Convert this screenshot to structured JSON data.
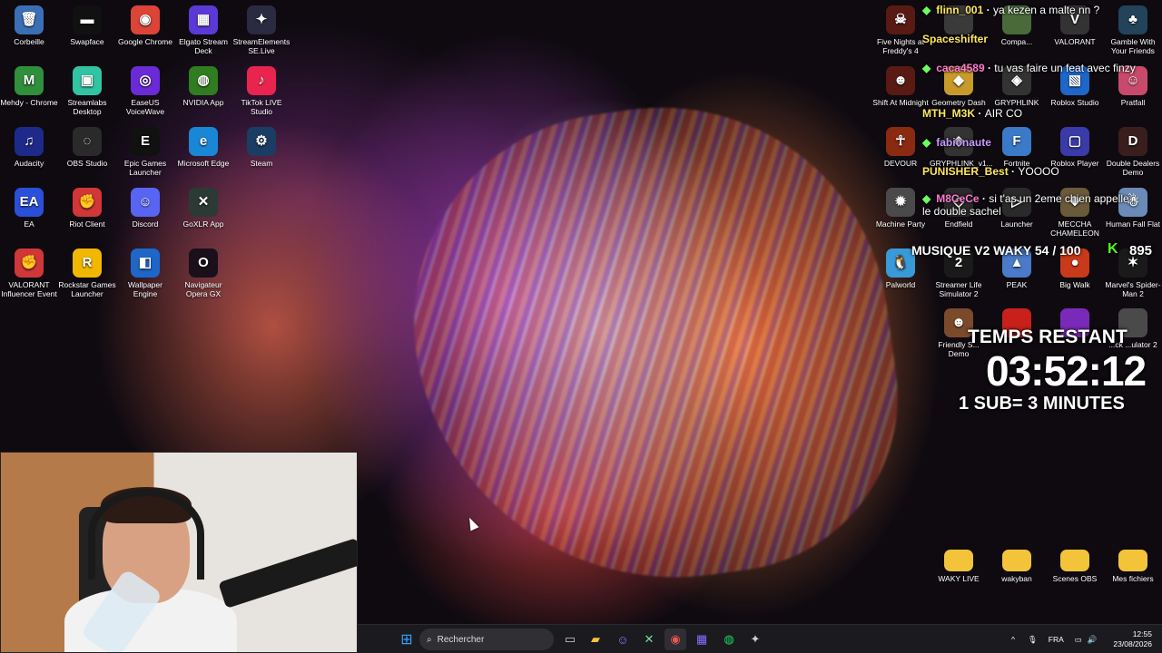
{
  "desktop_left": [
    {
      "label": "Corbeille",
      "icon": "recycle-bin-icon",
      "color": "#3b6fb5",
      "glyph": "🗑"
    },
    {
      "label": "Swapface",
      "icon": "mask-icon",
      "color": "#111111",
      "glyph": "▬"
    },
    {
      "label": "Google Chrome",
      "icon": "chrome-icon",
      "color": "#db4437",
      "glyph": "◉"
    },
    {
      "label": "Elgato Stream Deck",
      "icon": "stream-deck-icon",
      "color": "#5b39d6",
      "glyph": "▦"
    },
    {
      "label": "StreamElements SE.Live",
      "icon": "streamelements-icon",
      "color": "#2a2a40",
      "glyph": "✦"
    },
    {
      "label": "Mehdy - Chrome",
      "icon": "chrome-profile-icon",
      "color": "#2f8f3a",
      "glyph": "M"
    },
    {
      "label": "Streamlabs Desktop",
      "icon": "streamlabs-icon",
      "color": "#31c3a2",
      "glyph": "▣"
    },
    {
      "label": "EaseUS VoiceWave",
      "icon": "voicewave-icon",
      "color": "#6a2bd6",
      "glyph": "◎"
    },
    {
      "label": "NVIDIA App",
      "icon": "nvidia-icon",
      "color": "#2f7d1e",
      "glyph": "◍"
    },
    {
      "label": "TikTok LIVE Studio",
      "icon": "tiktok-icon",
      "color": "#e8244f",
      "glyph": "♪"
    },
    {
      "label": "Audacity",
      "icon": "audacity-icon",
      "color": "#1e2a8a",
      "glyph": "♫"
    },
    {
      "label": "OBS Studio",
      "icon": "obs-icon",
      "color": "#2a2a2a",
      "glyph": "◌"
    },
    {
      "label": "Epic Games Launcher",
      "icon": "epic-games-icon",
      "color": "#111111",
      "glyph": "E"
    },
    {
      "label": "Microsoft Edge",
      "icon": "edge-icon",
      "color": "#1a86d6",
      "glyph": "e"
    },
    {
      "label": "Steam",
      "icon": "steam-icon",
      "color": "#1b3c63",
      "glyph": "⚙"
    },
    {
      "label": "EA",
      "icon": "ea-icon",
      "color": "#2a4fd8",
      "glyph": "EA"
    },
    {
      "label": "Riot Client",
      "icon": "riot-client-icon",
      "color": "#d13639",
      "glyph": "✊"
    },
    {
      "label": "Discord",
      "icon": "discord-icon",
      "color": "#5865f2",
      "glyph": "☺"
    },
    {
      "label": "GoXLR App",
      "icon": "goxlr-icon",
      "color": "#2c3a35",
      "glyph": "✕"
    },
    {
      "label": "",
      "icon": "blank-icon",
      "color": "transparent",
      "glyph": ""
    },
    {
      "label": "VALORANT Influencer Event",
      "icon": "riot-event-icon",
      "color": "#d13639",
      "glyph": "✊"
    },
    {
      "label": "Rockstar Games Launcher",
      "icon": "rockstar-icon",
      "color": "#f2b700",
      "glyph": "R"
    },
    {
      "label": "Wallpaper Engine",
      "icon": "wallpaper-engine-icon",
      "color": "#1e66c8",
      "glyph": "◧"
    },
    {
      "label": "Navigateur Opera GX",
      "icon": "opera-gx-icon",
      "color": "#1a0f1a",
      "glyph": "O"
    }
  ],
  "desktop_right": [
    {
      "label": "Five Nights at Freddy's 4",
      "icon": "fnaf-icon",
      "color": "#5a1a14",
      "glyph": "☠"
    },
    {
      "label": "",
      "icon": "game-icon",
      "color": "#3a3a3a",
      "glyph": ""
    },
    {
      "label": "Compa...",
      "icon": "game-icon",
      "color": "#4a6a3a",
      "glyph": ""
    },
    {
      "label": "VALORANT",
      "icon": "valorant-icon",
      "color": "#333333",
      "glyph": "V"
    },
    {
      "label": "Gamble With Your Friends",
      "icon": "gamble-icon",
      "color": "#22435a",
      "glyph": "♣"
    },
    {
      "label": "Shift At Midnight",
      "icon": "shift-midnight-icon",
      "color": "#5a1a14",
      "glyph": "☻"
    },
    {
      "label": "Geometry Dash",
      "icon": "geometry-dash-icon",
      "color": "#c89a2a",
      "glyph": "◆"
    },
    {
      "label": "GRYPHLINK",
      "icon": "gryphlink-icon",
      "color": "#333333",
      "glyph": "◈"
    },
    {
      "label": "Roblox Studio",
      "icon": "roblox-studio-icon",
      "color": "#1e66c8",
      "glyph": "▧"
    },
    {
      "label": "Pratfall",
      "icon": "pratfall-icon",
      "color": "#c84a6a",
      "glyph": "☺"
    },
    {
      "label": "DEVOUR",
      "icon": "devour-icon",
      "color": "#8a2a10",
      "glyph": "☥"
    },
    {
      "label": "GRYPHLINK_v1...",
      "icon": "gryphlink-icon",
      "color": "#333333",
      "glyph": "◈"
    },
    {
      "label": "Fortnite",
      "icon": "fortnite-icon",
      "color": "#3a7ac8",
      "glyph": "F"
    },
    {
      "label": "Roblox Player",
      "icon": "roblox-player-icon",
      "color": "#3a3aa8",
      "glyph": "▢"
    },
    {
      "label": "Double Dealers Demo",
      "icon": "double-dealers-icon",
      "color": "#3a1e1e",
      "glyph": "D"
    },
    {
      "label": "Machine Party",
      "icon": "machine-party-icon",
      "color": "#4a4a4a",
      "glyph": "✹"
    },
    {
      "label": "Endfield",
      "icon": "endfield-icon",
      "color": "#2a2a2a",
      "glyph": "◇"
    },
    {
      "label": "Launcher",
      "icon": "launcher-icon",
      "color": "#2a2a2a",
      "glyph": "▷"
    },
    {
      "label": "MECCHA CHAMELEON",
      "icon": "meccha-icon",
      "color": "#6a5a3a",
      "glyph": "❖"
    },
    {
      "label": "Human Fall Flat",
      "icon": "human-fall-flat-icon",
      "color": "#6a8ab8",
      "glyph": "☃"
    },
    {
      "label": "Palworld",
      "icon": "palworld-icon",
      "color": "#3a9ad8",
      "glyph": "🐧"
    },
    {
      "label": "Streamer Life Simulator 2",
      "icon": "streamer-life-icon",
      "color": "#1a1a1a",
      "glyph": "2"
    },
    {
      "label": "PEAK",
      "icon": "peak-icon",
      "color": "#4a7ac8",
      "glyph": "▲"
    },
    {
      "label": "Big Walk",
      "icon": "big-walk-icon",
      "color": "#c83a1a",
      "glyph": "●"
    },
    {
      "label": "Marvel's Spider-Man 2",
      "icon": "spiderman-icon",
      "color": "#1a1a1a",
      "glyph": "✶"
    },
    {
      "label": "",
      "icon": "game-icon",
      "color": "transparent",
      "glyph": ""
    },
    {
      "label": "Friendly S... Demo",
      "icon": "friendly-icon",
      "color": "#7a4a2a",
      "glyph": "☻"
    },
    {
      "label": "",
      "icon": "game-icon",
      "color": "#c8201a",
      "glyph": ""
    },
    {
      "label": "",
      "icon": "game-icon",
      "color": "#7a2ab8",
      "glyph": ""
    },
    {
      "label": "...ck ...ulator 2",
      "icon": "game-icon",
      "color": "#4a4a4a",
      "glyph": ""
    }
  ],
  "desktop_folders": [
    {
      "label": "WAKY LIVE"
    },
    {
      "label": "wakyban"
    },
    {
      "label": "Scenes OBS"
    },
    {
      "label": "Mes fichiers"
    }
  ],
  "chat": [
    {
      "user": "flinn_001",
      "text": "ya kezen a malte nn ?",
      "badge": true,
      "color": "yellow"
    },
    {
      "user": "Spaceshifter",
      "text": "",
      "badge": false,
      "color": "yellow"
    },
    {
      "user": "caca4589",
      "text": "tu vas faire un feat avec finzy",
      "badge": true,
      "color": "pink"
    },
    {
      "user": "MTH_M3K",
      "text": "AIR CO",
      "badge": false,
      "color": "yellow"
    },
    {
      "user": "fabionaute",
      "text": "",
      "badge": true,
      "color": "purple"
    },
    {
      "user": "PUNISHER_Best",
      "text": "YOOOO",
      "badge": false,
      "color": "yellow"
    },
    {
      "user": "M8CeCe",
      "text": "si t'as un 2eme chien appelle le double sachel",
      "badge": true,
      "color": "pink"
    }
  ],
  "overlay": {
    "music_goal": "MUSIQUE V2 WAKY 54 / 100",
    "kick_label": "K",
    "kick_count": "895",
    "timer_title": "TEMPS RESTANT",
    "timer_value": "03:52:12",
    "timer_rule": "1 SUB= 3 MINUTES"
  },
  "taskbar": {
    "search_placeholder": "Rechercher",
    "language": "FRA",
    "time": "12:55",
    "date": "23/08/2026",
    "apps": [
      "windows-start-icon",
      "file-explorer-icon",
      "folder-icon",
      "discord-icon",
      "goxlr-icon",
      "chrome-icon",
      "stream-deck-icon",
      "spotify-icon",
      "streamelements-icon"
    ]
  },
  "colors": {
    "chat_name_yellow": "#ffe75c",
    "chat_badge_green": "#6bff5a",
    "kick_green": "#53fc18",
    "taskbar_bg": "#1b1b1f"
  }
}
